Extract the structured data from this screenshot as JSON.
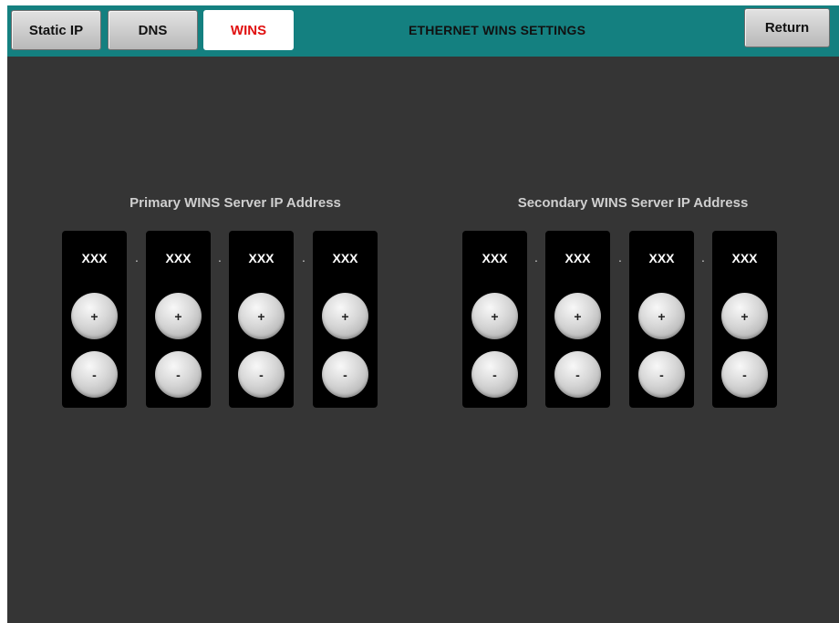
{
  "header": {
    "tabs": [
      {
        "label": "Static IP"
      },
      {
        "label": "DNS"
      },
      {
        "label": "WINS"
      }
    ],
    "title": "ETHERNET WINS SETTINGS",
    "return_label": "Return"
  },
  "primary": {
    "label": "Primary WINS Server IP Address",
    "octets": [
      "XXX",
      "XXX",
      "XXX",
      "XXX"
    ]
  },
  "secondary": {
    "label": "Secondary WINS Server IP Address",
    "octets": [
      "XXX",
      "XXX",
      "XXX",
      "XXX"
    ]
  },
  "controls": {
    "increment": "+",
    "decrement": "-",
    "separator": "."
  },
  "colors": {
    "header_bg": "#148080",
    "screen_bg": "#353535",
    "active_tab_text": "#e01010"
  },
  "icons": {
    "increment": "plus-icon",
    "decrement": "minus-icon"
  }
}
